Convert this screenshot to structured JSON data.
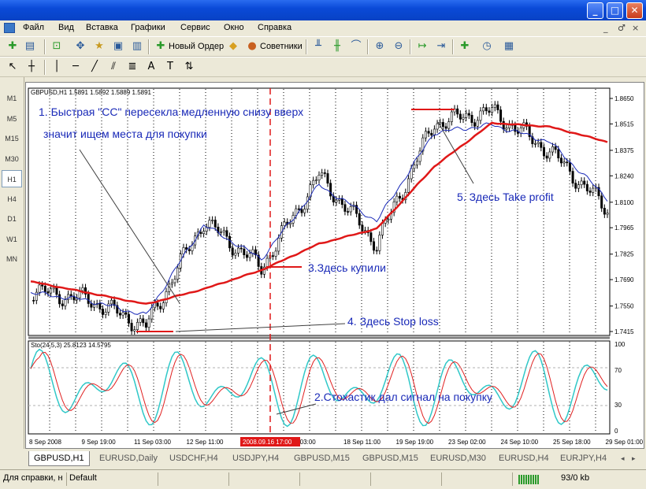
{
  "window": {
    "controls": [
      "_",
      "□",
      "✕"
    ]
  },
  "menu": {
    "items": [
      "Файл",
      "Вид",
      "Вставка",
      "Графики",
      "Сервис",
      "Окно",
      "Справка"
    ],
    "mdi_controls": [
      "_",
      "♂",
      "×"
    ]
  },
  "toolbar": {
    "new_order_label": "Новый Ордер",
    "advisors_label": "Советники"
  },
  "timeframes": [
    "M1",
    "M5",
    "M15",
    "M30",
    "H1",
    "H4",
    "D1",
    "W1",
    "MN"
  ],
  "active_timeframe": "H1",
  "chart": {
    "header": "GBPUSD,H1  1.5891 1.5892 1.5889 1.5891",
    "price_axis": [
      "1.8650",
      "1.8515",
      "1.8375",
      "1.8240",
      "1.8100",
      "1.7965",
      "1.7825",
      "1.7690",
      "1.7550",
      "1.7415"
    ],
    "stoch_header": "Sto(24,5,3) 25.8123 14.5795",
    "stoch_axis": [
      "100",
      "70",
      "30",
      "0"
    ],
    "time_axis": [
      "8 Sep 2008",
      "9 Sep 19:00",
      "11 Sep 03:00",
      "12 Sep 11:00",
      "",
      "ep 03:00",
      "18 Sep 11:00",
      "19 Sep 19:00",
      "23 Sep 02:00",
      "24 Sep 10:00",
      "25 Sep 18:00",
      "29 Sep 01:00"
    ],
    "time_highlight": "2008.09.16 17:00",
    "annotations": {
      "a1_line1": "1. Быстрая \"СС\" пересекла медленную снизу вверх",
      "a1_line2": "значит ищем места для покупки",
      "a2": "2.Стохастик дал сигнал на покупку",
      "a3": "3.Здесь купили",
      "a4": "4. Здесь Stop loss",
      "a5": "5. Здесь Take profit"
    },
    "colors": {
      "fast_ma": "#1a2ab8",
      "slow_ma": "#e01818",
      "stoch_main": "#30c8c8",
      "stoch_signal": "#e02020",
      "annotation_text": "#1a2ab8",
      "highlight": "#e01818"
    }
  },
  "chart_data": {
    "type": "line",
    "title": "GBPUSD,H1",
    "x": [
      "8 Sep 2008",
      "9 Sep 19:00",
      "11 Sep 03:00",
      "12 Sep 11:00",
      "16 Sep 17:00",
      "18 Sep 11:00",
      "19 Sep 19:00",
      "23 Sep 02:00",
      "24 Sep 10:00",
      "25 Sep 18:00",
      "29 Sep 01:00"
    ],
    "series": [
      {
        "values": [
          1.763,
          1.7585,
          1.744,
          1.8,
          1.7755,
          1.824,
          1.788,
          1.852,
          1.858,
          1.837,
          1.806
        ]
      },
      {
        "values": [
          1.762,
          1.758,
          1.75,
          1.798,
          1.78,
          1.819,
          1.8,
          1.847,
          1.851,
          1.842,
          1.812
        ]
      },
      {
        "values": [
          1.768,
          1.762,
          1.756,
          1.764,
          1.774,
          1.788,
          1.796,
          1.829,
          1.852,
          1.85,
          1.842
        ]
      }
    ],
    "ylim": [
      1.7415,
      1.865
    ],
    "stochastic": {
      "ylim": [
        0,
        100
      ],
      "levels": [
        30,
        70
      ]
    }
  }
}
